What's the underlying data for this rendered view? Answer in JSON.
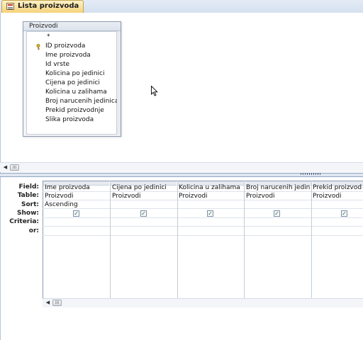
{
  "tab": {
    "label": "Lista proizvoda",
    "icon": "query-icon"
  },
  "table_box": {
    "title": "Proizvodi",
    "fields": [
      "*",
      "ID proizvoda",
      "Ime proizvoda",
      "Id vrste",
      "Kolicina po jedinici",
      "Cijena po jedinici",
      "Kolicina u zalihama",
      "Broj narucenih jedinica",
      "Prekid proizvodnje",
      "Slika proizvoda"
    ],
    "primary_key_icon": "key-icon"
  },
  "grid": {
    "row_labels": {
      "field": "Field:",
      "table": "Table:",
      "sort": "Sort:",
      "show": "Show:",
      "criteria": "Criteria:",
      "or": "or:"
    },
    "columns": [
      {
        "field": "Ime proizvoda",
        "table": "Proizvodi",
        "sort": "Ascending",
        "show": true
      },
      {
        "field": "Cijena po jedinici",
        "table": "Proizvodi",
        "sort": "",
        "show": true
      },
      {
        "field": "Kolicina u zalihama",
        "table": "Proizvodi",
        "sort": "",
        "show": true
      },
      {
        "field": "Broj narucenih jedinica",
        "table": "Proizvodi",
        "sort": "",
        "show": true
      },
      {
        "field": "Prekid proizvodnje",
        "table": "Proizvodi",
        "sort": "",
        "show": true
      }
    ]
  },
  "scrollbars": {
    "left_arrow": "◀",
    "thumb": "III"
  },
  "checkmark": "✓"
}
